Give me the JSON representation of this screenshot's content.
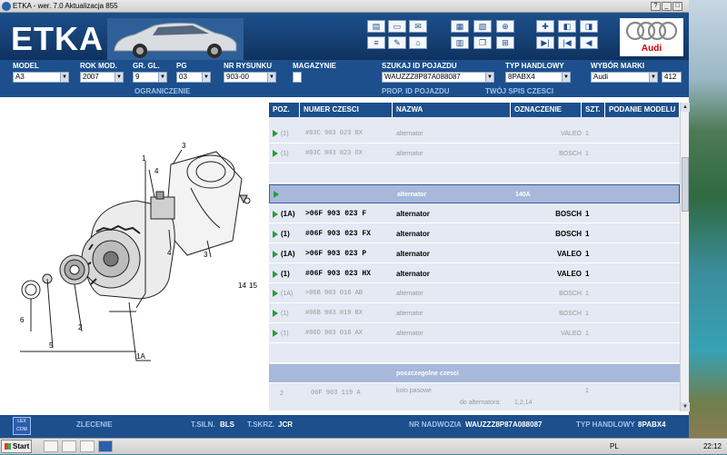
{
  "window": {
    "title": "ETKA - wer. 7.0 Aktualizacja 855",
    "controls": [
      "?",
      "_",
      "□",
      "x"
    ]
  },
  "header": {
    "logo": "ETKA",
    "brand": "Audi"
  },
  "fields": {
    "model": {
      "label": "MODEL",
      "value": "A3"
    },
    "rok_mod": {
      "label": "ROK MOD.",
      "value": "2007"
    },
    "gr_gl": {
      "label": "GR. GL.",
      "value": "9"
    },
    "pg": {
      "label": "PG",
      "value": "03"
    },
    "nr_rysunku": {
      "label": "NR RYSUNKU",
      "value": "903-00"
    },
    "magazynie": {
      "label": "MAGAZYNIE"
    },
    "szukaj": {
      "label": "SZUKAJ ID POJAZDU",
      "value": "WAUZZZ8P87A088087"
    },
    "typ_handlowy": {
      "label": "TYP HANDLOWY",
      "value": "8PABX4"
    },
    "wybor_marki": {
      "label": "WYBÓR MARKI",
      "value": "Audi",
      "count": "412"
    }
  },
  "links": {
    "ograniczenie": "OGRANICZENIE",
    "prop_id": "PROP. ID POJAZDU",
    "spis": "TWÓJ SPIS CZESCI"
  },
  "table": {
    "headers": [
      "POZ.",
      "NUMER CZESCI",
      "NAZWA",
      "OZNACZENIE",
      "SZT.",
      "PODANIE MODELU"
    ],
    "rows": [
      {
        "poz": "(1)",
        "num": "#03C 903 023 BX",
        "name": "alternator",
        "ozn": "VALEO",
        "szt": "1",
        "style": "grey"
      },
      {
        "poz": "(1)",
        "num": "#03C 903 023 DX",
        "name": "alternator",
        "ozn": "BOSCH",
        "szt": "1",
        "style": "grey"
      },
      {
        "poz": "",
        "num": "",
        "name": "",
        "ozn": "",
        "szt": "",
        "style": "blank"
      },
      {
        "poz": "",
        "num": "",
        "name": "alternator",
        "ozn": "140A",
        "szt": "",
        "style": "hl"
      },
      {
        "poz": "(1A)",
        "num": ">06F 903 023 F",
        "name": "alternator",
        "ozn": "BOSCH",
        "szt": "1",
        "style": "bold"
      },
      {
        "poz": "(1)",
        "num": "#06F 903 023 FX",
        "name": "alternator",
        "ozn": "BOSCH",
        "szt": "1",
        "style": "bold"
      },
      {
        "poz": "(1A)",
        "num": ">06F 903 023 P",
        "name": "alternator",
        "ozn": "VALEO",
        "szt": "1",
        "style": "bold"
      },
      {
        "poz": "(1)",
        "num": "#06F 903 023 HX",
        "name": "alternator",
        "ozn": "VALEO",
        "szt": "1",
        "style": "bold"
      },
      {
        "poz": "(1A)",
        "num": ">06B 903 016 AB",
        "name": "alternator",
        "ozn": "BOSCH",
        "szt": "1",
        "style": "grey"
      },
      {
        "poz": "(1)",
        "num": "#06B 903 019 BX",
        "name": "alternator",
        "ozn": "BOSCH",
        "szt": "1",
        "style": "grey"
      },
      {
        "poz": "(1)",
        "num": "#06D 903 016 AX",
        "name": "alternator",
        "ozn": "VALEO",
        "szt": "1",
        "style": "grey"
      },
      {
        "poz": "",
        "num": "",
        "name": "",
        "ozn": "",
        "szt": "",
        "style": "blank"
      },
      {
        "poz": "",
        "num": "",
        "name": "poszczegolne czesci",
        "ozn": "",
        "szt": "",
        "style": "sec"
      },
      {
        "poz": "2",
        "num": "06F 903 119 A",
        "name": "kolo pasowe",
        "sub": "do alternatora:",
        "subval": "1,2,14",
        "ozn": "",
        "szt": "1",
        "style": "grey2"
      }
    ]
  },
  "diagram": {
    "labels": [
      "1",
      "2",
      "3",
      "4",
      "5",
      "6",
      "14",
      "15",
      "1A"
    ]
  },
  "footer": {
    "lexcom": "LEX COM",
    "zlecenie": "ZLECENIE",
    "tsiln_label": "T.SILN.",
    "tsiln": "BLS",
    "tskrz_label": "T.SKRZ.",
    "tskrz": "JCR",
    "nr_label": "NR NADWOZIA",
    "nr": "WAUZZZ8P87A088087",
    "typ_label": "TYP HANDLOWY",
    "typ": "8PABX4"
  },
  "taskbar": {
    "start": "Start",
    "lang": "PL",
    "clock": "22:12"
  },
  "colors": {
    "header_blue": "#1c4f8c",
    "highlight_row": "#a7b8da",
    "arrow_green": "#2a9d3a"
  }
}
